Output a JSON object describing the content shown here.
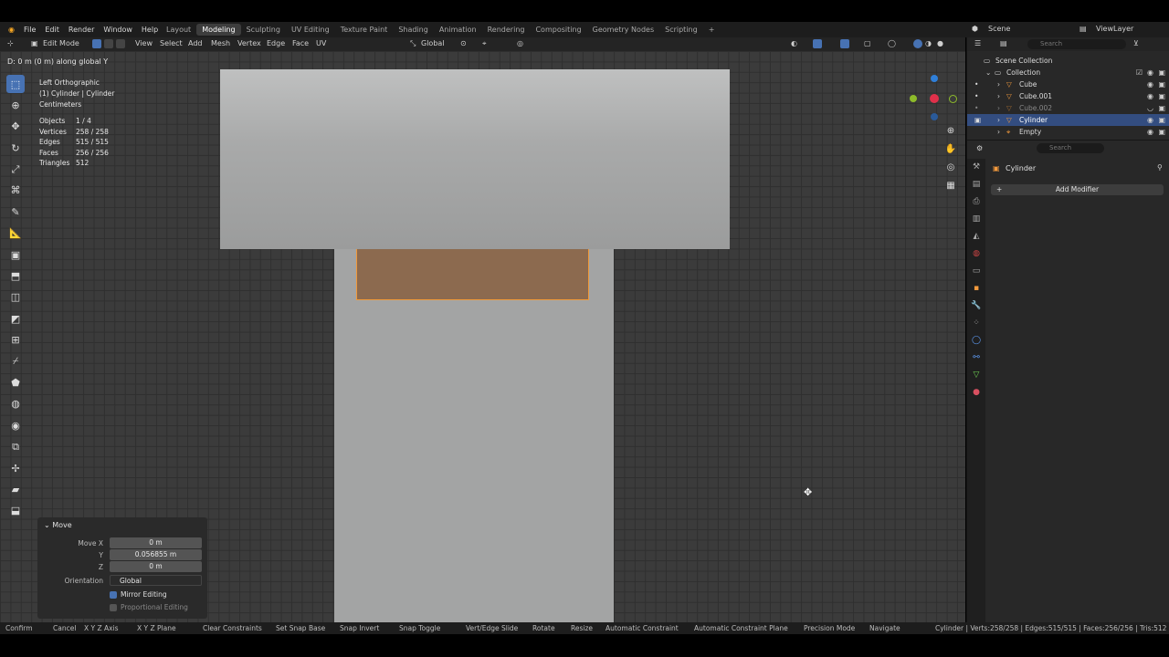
{
  "menus": [
    "File",
    "Edit",
    "Render",
    "Window",
    "Help"
  ],
  "workspace_tabs": [
    "Layout",
    "Modeling",
    "Sculpting",
    "UV Editing",
    "Texture Paint",
    "Shading",
    "Animation",
    "Rendering",
    "Compositing",
    "Geometry Nodes",
    "Scripting"
  ],
  "active_tab": "Modeling",
  "scene": "Scene",
  "view_layer": "ViewLayer",
  "header": {
    "mode": "Edit Mode",
    "view": "View",
    "select": "Select",
    "add": "Add",
    "mesh": "Mesh",
    "vertex": "Vertex",
    "edge": "Edge",
    "face": "Face",
    "uv": "UV",
    "orientation": "Global"
  },
  "viewport": {
    "status_message": "D: 0 m (0 m) along global Y",
    "view_name": "Left Orthographic",
    "object_line": "(1) Cylinder | Cylinder",
    "units": "Centimeters",
    "stats": [
      {
        "k": "Objects",
        "v": "1 / 4"
      },
      {
        "k": "Vertices",
        "v": "258 / 258"
      },
      {
        "k": "Edges",
        "v": "515 / 515"
      },
      {
        "k": "Faces",
        "v": "256 / 256"
      },
      {
        "k": "Triangles",
        "v": "512"
      }
    ]
  },
  "operator": {
    "title": "Move",
    "move_x_label": "Move X",
    "move_x": "0 m",
    "y_label": "Y",
    "y": "0.056855 m",
    "z_label": "Z",
    "z": "0 m",
    "orientation_label": "Orientation",
    "orientation": "Global",
    "mirror_editing": "Mirror Editing",
    "proportional_editing": "Proportional Editing"
  },
  "outliner": {
    "search_placeholder": "Search",
    "scene_collection": "Scene Collection",
    "collection": "Collection",
    "items": [
      "Cube",
      "Cube.001",
      "Cube.002",
      "Cylinder",
      "Empty"
    ]
  },
  "properties": {
    "search_placeholder": "Search",
    "object_name": "Cylinder",
    "add_modifier": "Add Modifier"
  },
  "statusbar": {
    "hints": [
      "Confirm",
      "Cancel",
      "X Y Z Axis",
      "X Y Z Plane",
      "Clear Constraints",
      "Set Snap Base",
      "Snap Invert",
      "Snap Toggle",
      "Vert/Edge Slide",
      "Rotate",
      "Resize",
      "Automatic Constraint",
      "Automatic Constraint Plane",
      "Precision Mode",
      "Navigate"
    ],
    "info": "Cylinder | Verts:258/258 | Edges:515/515 | Faces:256/256 | Tris:512 |"
  },
  "colors": {
    "selection_orange": "#f09a3b",
    "active_blue": "#4772b3"
  }
}
